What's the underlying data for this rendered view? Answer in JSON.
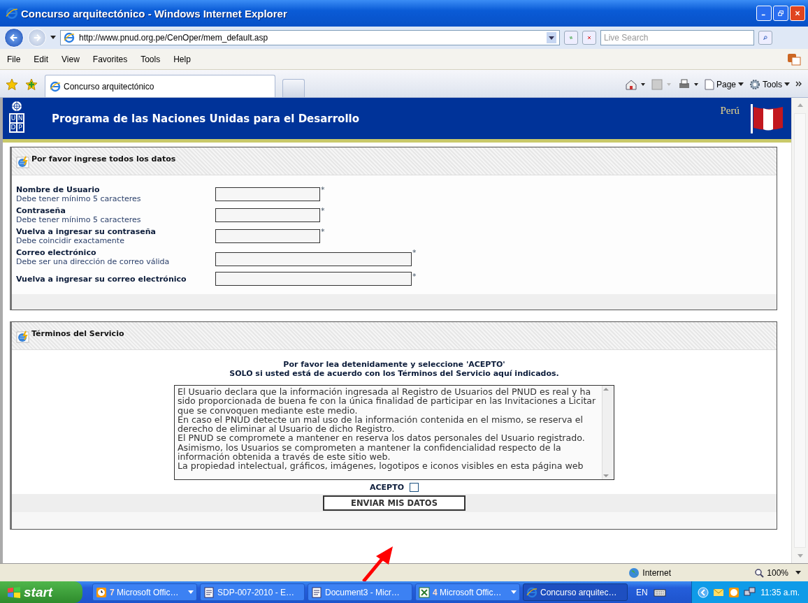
{
  "window": {
    "title": "Concurso arquitectónico - Windows Internet Explorer"
  },
  "address_bar": {
    "url": "http://www.pnud.org.pe/CenOper/mem_default.asp"
  },
  "search": {
    "placeholder": "Live Search"
  },
  "menu": [
    "File",
    "Edit",
    "View",
    "Favorites",
    "Tools",
    "Help"
  ],
  "tabs": [
    {
      "label": "Concurso arquitectónico",
      "selected": true
    }
  ],
  "command_bar": [
    "Page",
    "Tools"
  ],
  "banner": {
    "logo_letters": [
      "U",
      "N",
      "D",
      "P"
    ],
    "title": "Programa de las Naciones Unidas para el Desarrollo",
    "country": "Perú"
  },
  "registration_panel": {
    "title": "Por favor ingrese todos los datos",
    "fields": [
      {
        "label": "Nombre de Usuario",
        "hint": "Debe tener mínimo 5 caracteres",
        "kind": "short",
        "required_mark": "*"
      },
      {
        "label": "Contraseña",
        "hint": "Debe tener mínimo 5 caracteres",
        "kind": "short",
        "required_mark": "*"
      },
      {
        "label": "Vuelva a ingresar su contraseña",
        "hint": "Debe coincidir exactamente",
        "kind": "short",
        "required_mark": "*"
      },
      {
        "label": "Correo electrónico",
        "hint": "Debe ser una dirección de correo válida",
        "kind": "long",
        "required_mark": "*"
      },
      {
        "label": "Vuelva a ingresar su correo electrónico",
        "kind": "long",
        "required_mark": "*"
      }
    ]
  },
  "terms_panel": {
    "title": "Términos del Servicio",
    "instructions": [
      "Por favor lea detenidamente y seleccione 'ACEPTO'",
      "SOLO si usted está de acuerdo con los Términos del Servicio aquí indicados."
    ],
    "terms_text": [
      "El Usuario declara que la información ingresada al Registro de Usuarios del PNUD es real y ha sido proporcionada de buena fe con la única finalidad de participar en las Invitaciones a Licitar que se convoquen mediante este medio.",
      "En caso el PNUD detecte un mal uso de la información contenida en el mismo, se reserva el derecho de eliminar al Usuario de dicho Registro.",
      "El PNUD se compromete a mantener en reserva los datos personales del Usuario registrado.",
      "Asimismo, los Usuarios se comprometen a mantener la confidencialidad respecto de la información obtenida a través de este sitio web.",
      "La propiedad intelectual, gráficos, imágenes, logotipos e iconos visibles en esta página web"
    ],
    "accept": {
      "label": "ACEPTO",
      "checked": false
    },
    "submit_button": "ENVIAR MIS DATOS"
  },
  "status_bar": {
    "zone": "Internet",
    "zoom": "100%"
  },
  "taskbar": {
    "start": "start",
    "items": [
      {
        "count": "7",
        "label": "Microsoft Offic…",
        "kind": "group",
        "selected": false
      },
      {
        "label": "SDP-007-2010 - E…",
        "kind": "word",
        "selected": false
      },
      {
        "label": "Document3 - Micr…",
        "kind": "word",
        "selected": false
      },
      {
        "count": "4",
        "label": "Microsoft Offic…",
        "kind": "excel-group",
        "selected": false
      },
      {
        "label": "Concurso arquitec…",
        "kind": "browser",
        "selected": true
      }
    ],
    "language": "EN",
    "clock": "11:35 a.m."
  }
}
